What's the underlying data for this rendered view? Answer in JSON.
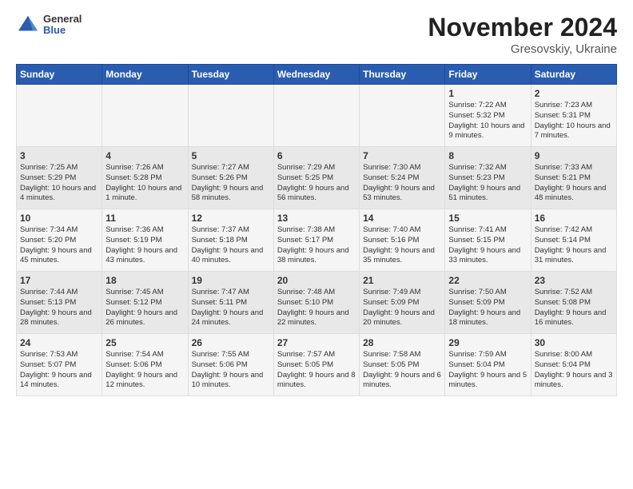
{
  "header": {
    "logo_general": "General",
    "logo_blue": "Blue",
    "month_title": "November 2024",
    "location": "Gresovskiy, Ukraine"
  },
  "days_of_week": [
    "Sunday",
    "Monday",
    "Tuesday",
    "Wednesday",
    "Thursday",
    "Friday",
    "Saturday"
  ],
  "weeks": [
    [
      {
        "num": "",
        "detail": ""
      },
      {
        "num": "",
        "detail": ""
      },
      {
        "num": "",
        "detail": ""
      },
      {
        "num": "",
        "detail": ""
      },
      {
        "num": "",
        "detail": ""
      },
      {
        "num": "1",
        "detail": "Sunrise: 7:22 AM\nSunset: 5:32 PM\nDaylight: 10 hours\nand 9 minutes."
      },
      {
        "num": "2",
        "detail": "Sunrise: 7:23 AM\nSunset: 5:31 PM\nDaylight: 10 hours\nand 7 minutes."
      }
    ],
    [
      {
        "num": "3",
        "detail": "Sunrise: 7:25 AM\nSunset: 5:29 PM\nDaylight: 10 hours\nand 4 minutes."
      },
      {
        "num": "4",
        "detail": "Sunrise: 7:26 AM\nSunset: 5:28 PM\nDaylight: 10 hours\nand 1 minute."
      },
      {
        "num": "5",
        "detail": "Sunrise: 7:27 AM\nSunset: 5:26 PM\nDaylight: 9 hours\nand 58 minutes."
      },
      {
        "num": "6",
        "detail": "Sunrise: 7:29 AM\nSunset: 5:25 PM\nDaylight: 9 hours\nand 56 minutes."
      },
      {
        "num": "7",
        "detail": "Sunrise: 7:30 AM\nSunset: 5:24 PM\nDaylight: 9 hours\nand 53 minutes."
      },
      {
        "num": "8",
        "detail": "Sunrise: 7:32 AM\nSunset: 5:23 PM\nDaylight: 9 hours\nand 51 minutes."
      },
      {
        "num": "9",
        "detail": "Sunrise: 7:33 AM\nSunset: 5:21 PM\nDaylight: 9 hours\nand 48 minutes."
      }
    ],
    [
      {
        "num": "10",
        "detail": "Sunrise: 7:34 AM\nSunset: 5:20 PM\nDaylight: 9 hours\nand 45 minutes."
      },
      {
        "num": "11",
        "detail": "Sunrise: 7:36 AM\nSunset: 5:19 PM\nDaylight: 9 hours\nand 43 minutes."
      },
      {
        "num": "12",
        "detail": "Sunrise: 7:37 AM\nSunset: 5:18 PM\nDaylight: 9 hours\nand 40 minutes."
      },
      {
        "num": "13",
        "detail": "Sunrise: 7:38 AM\nSunset: 5:17 PM\nDaylight: 9 hours\nand 38 minutes."
      },
      {
        "num": "14",
        "detail": "Sunrise: 7:40 AM\nSunset: 5:16 PM\nDaylight: 9 hours\nand 35 minutes."
      },
      {
        "num": "15",
        "detail": "Sunrise: 7:41 AM\nSunset: 5:15 PM\nDaylight: 9 hours\nand 33 minutes."
      },
      {
        "num": "16",
        "detail": "Sunrise: 7:42 AM\nSunset: 5:14 PM\nDaylight: 9 hours\nand 31 minutes."
      }
    ],
    [
      {
        "num": "17",
        "detail": "Sunrise: 7:44 AM\nSunset: 5:13 PM\nDaylight: 9 hours\nand 28 minutes."
      },
      {
        "num": "18",
        "detail": "Sunrise: 7:45 AM\nSunset: 5:12 PM\nDaylight: 9 hours\nand 26 minutes."
      },
      {
        "num": "19",
        "detail": "Sunrise: 7:47 AM\nSunset: 5:11 PM\nDaylight: 9 hours\nand 24 minutes."
      },
      {
        "num": "20",
        "detail": "Sunrise: 7:48 AM\nSunset: 5:10 PM\nDaylight: 9 hours\nand 22 minutes."
      },
      {
        "num": "21",
        "detail": "Sunrise: 7:49 AM\nSunset: 5:09 PM\nDaylight: 9 hours\nand 20 minutes."
      },
      {
        "num": "22",
        "detail": "Sunrise: 7:50 AM\nSunset: 5:09 PM\nDaylight: 9 hours\nand 18 minutes."
      },
      {
        "num": "23",
        "detail": "Sunrise: 7:52 AM\nSunset: 5:08 PM\nDaylight: 9 hours\nand 16 minutes."
      }
    ],
    [
      {
        "num": "24",
        "detail": "Sunrise: 7:53 AM\nSunset: 5:07 PM\nDaylight: 9 hours\nand 14 minutes."
      },
      {
        "num": "25",
        "detail": "Sunrise: 7:54 AM\nSunset: 5:06 PM\nDaylight: 9 hours\nand 12 minutes."
      },
      {
        "num": "26",
        "detail": "Sunrise: 7:55 AM\nSunset: 5:06 PM\nDaylight: 9 hours\nand 10 minutes."
      },
      {
        "num": "27",
        "detail": "Sunrise: 7:57 AM\nSunset: 5:05 PM\nDaylight: 9 hours\nand 8 minutes."
      },
      {
        "num": "28",
        "detail": "Sunrise: 7:58 AM\nSunset: 5:05 PM\nDaylight: 9 hours\nand 6 minutes."
      },
      {
        "num": "29",
        "detail": "Sunrise: 7:59 AM\nSunset: 5:04 PM\nDaylight: 9 hours\nand 5 minutes."
      },
      {
        "num": "30",
        "detail": "Sunrise: 8:00 AM\nSunset: 5:04 PM\nDaylight: 9 hours\nand 3 minutes."
      }
    ]
  ]
}
